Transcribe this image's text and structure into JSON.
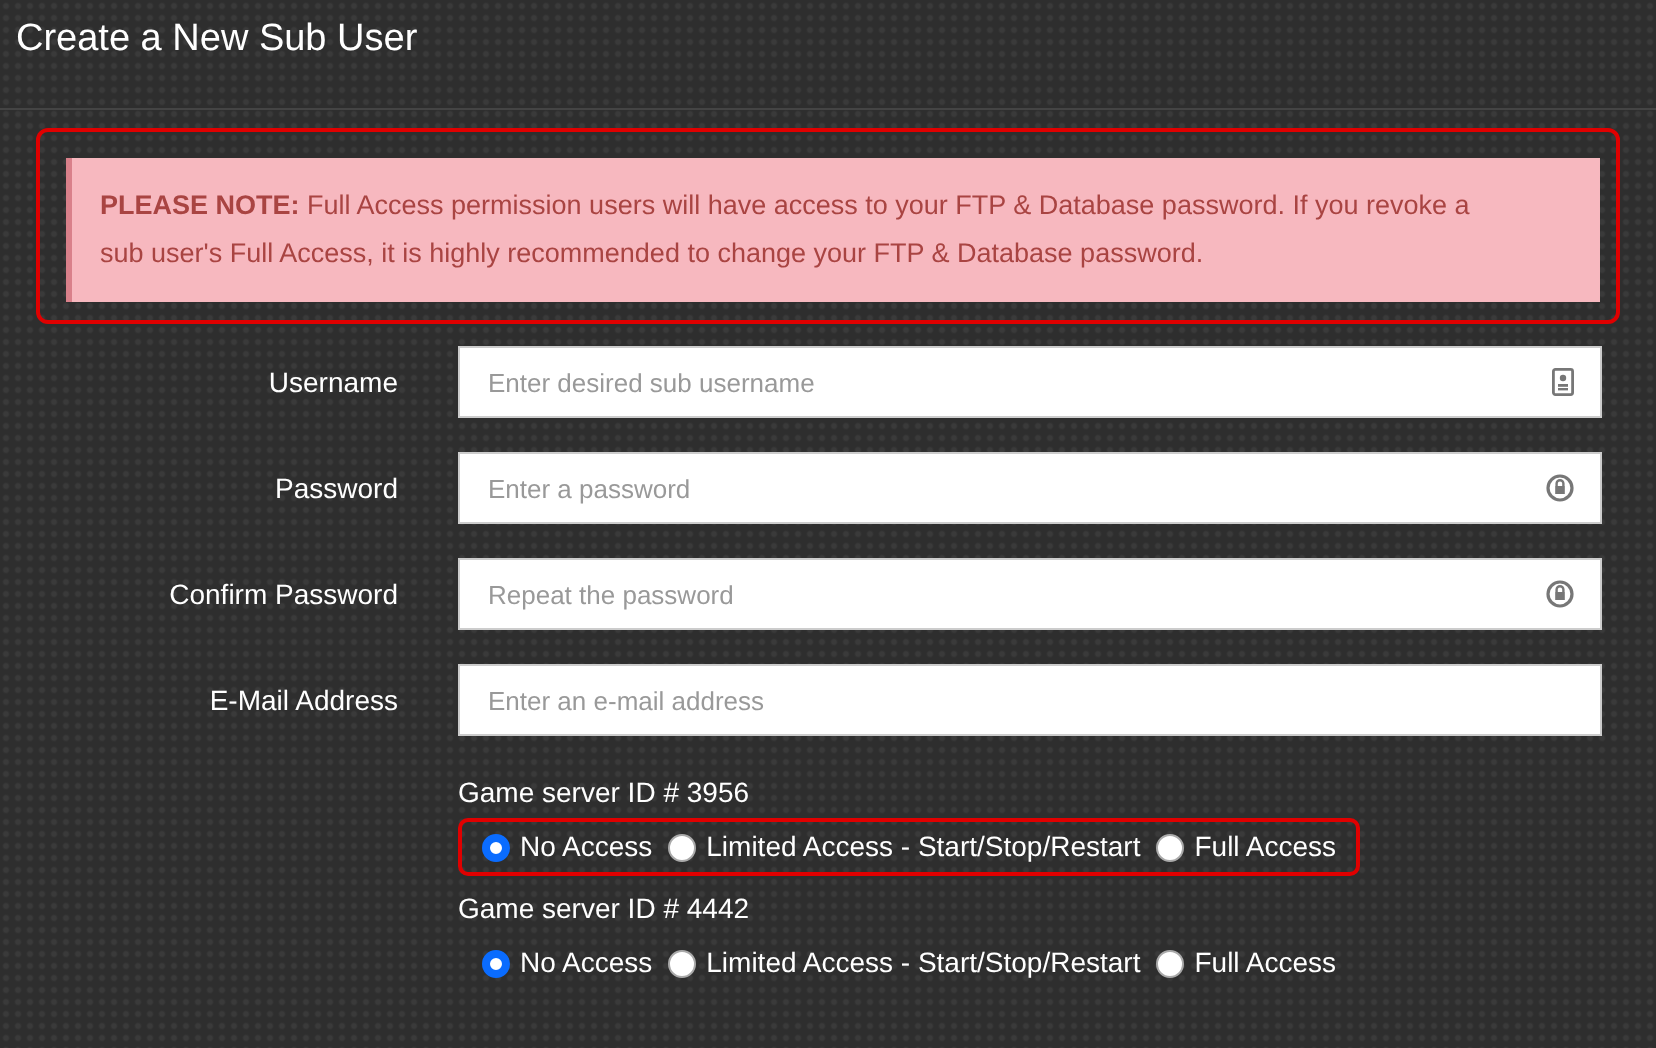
{
  "title": "Create a New Sub User",
  "note": {
    "highlighted": true,
    "text": "**PLEASE NOTE:** Full Access permission users will have access to your FTP & Database password. If you revoke a sub user's Full Access, it is highly recommended to change your FTP & Database password."
  },
  "fields": [
    {
      "label": "Username",
      "placeholder": "Enter desired sub username",
      "kind": "user"
    },
    {
      "label": "Password",
      "placeholder": "Enter a password",
      "kind": "lock"
    },
    {
      "label": "Confirm Password",
      "placeholder": "Repeat the password",
      "kind": "lock"
    },
    {
      "label": "E-Mail Address",
      "placeholder": "Enter an e-mail address",
      "kind": "plain"
    }
  ],
  "servers": [
    {
      "label": "Game server ID # 3956",
      "highlighted": true,
      "options": [
        {
          "label": "No Access",
          "selected": true
        },
        {
          "label": "Limited Access - Start/Stop/Restart",
          "selected": false
        },
        {
          "label": "Full Access",
          "selected": false
        }
      ]
    },
    {
      "label": "Game server ID # 4442",
      "highlighted": false,
      "options": [
        {
          "label": "No Access",
          "selected": true
        },
        {
          "label": "Limited Access - Start/Stop/Restart",
          "selected": false
        },
        {
          "label": "Full Access",
          "selected": false
        }
      ]
    }
  ]
}
